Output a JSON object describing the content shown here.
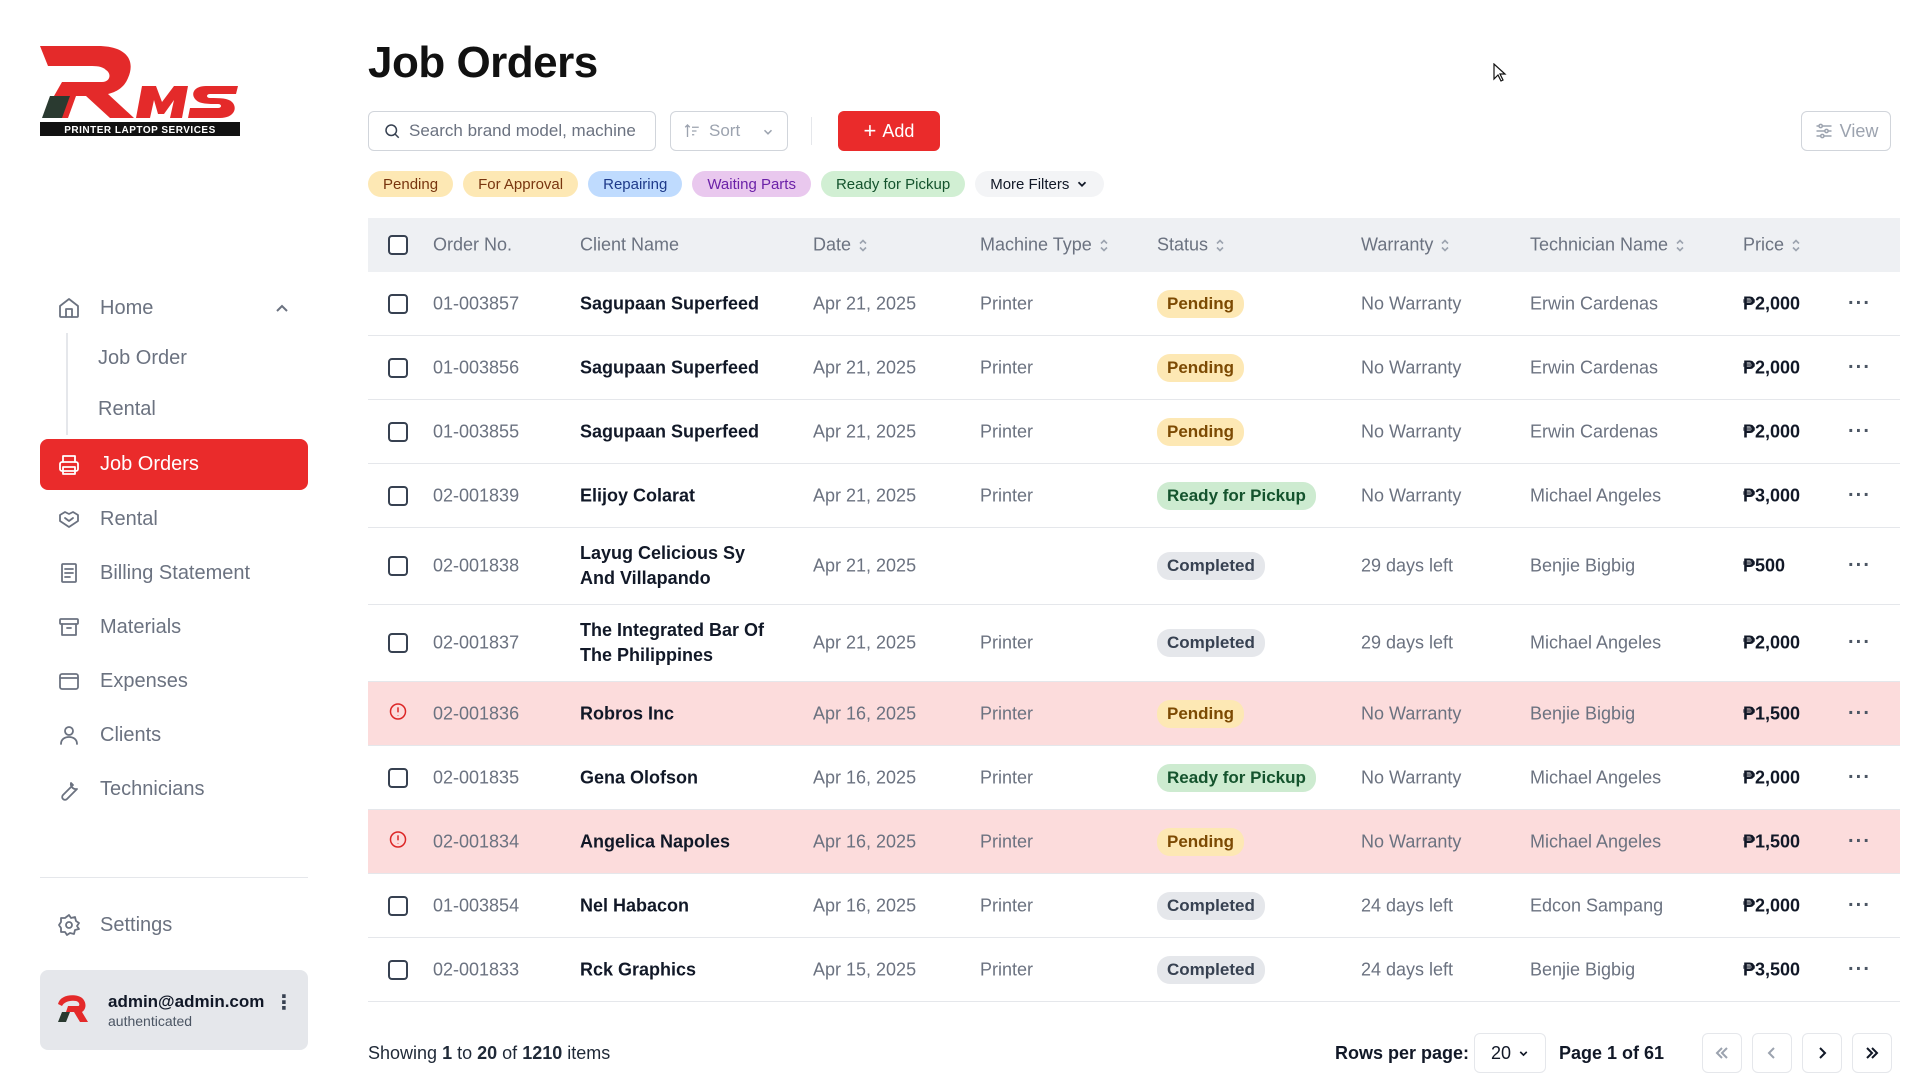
{
  "app": {
    "logo_text": "PRINTER LAPTOP SERVICES",
    "logo_mark": "RMS",
    "brand_color": "#ea2b2b"
  },
  "sidebar": {
    "home": {
      "label": "Home",
      "icon": "home-icon",
      "expanded": true
    },
    "home_children": [
      {
        "label": "Job Order"
      },
      {
        "label": "Rental"
      }
    ],
    "items": [
      {
        "label": "Job Orders",
        "icon": "printer-icon",
        "active": true
      },
      {
        "label": "Rental",
        "icon": "handshake-icon"
      },
      {
        "label": "Billing Statement",
        "icon": "document-icon"
      },
      {
        "label": "Materials",
        "icon": "archive-icon"
      },
      {
        "label": "Expenses",
        "icon": "wallet-icon"
      },
      {
        "label": "Clients",
        "icon": "user-icon"
      },
      {
        "label": "Technicians",
        "icon": "wrench-icon"
      }
    ],
    "settings": {
      "label": "Settings",
      "icon": "gear-icon"
    },
    "user": {
      "email": "admin@admin.com",
      "status": "authenticated"
    }
  },
  "page": {
    "title": "Job Orders"
  },
  "toolbar": {
    "search_placeholder": "Search brand model, machine",
    "sort_label": "Sort",
    "add_label": "Add",
    "view_label": "View"
  },
  "filters": [
    {
      "label": "Pending",
      "bg": "#fde8b4",
      "fg": "#78350f"
    },
    {
      "label": "For Approval",
      "bg": "#fde8b4",
      "fg": "#78350f"
    },
    {
      "label": "Repairing",
      "bg": "#bfdbfe",
      "fg": "#1e3a8a"
    },
    {
      "label": "Waiting Parts",
      "bg": "#e9c8ee",
      "fg": "#6b21a8"
    },
    {
      "label": "Ready for Pickup",
      "bg": "#d1efd3",
      "fg": "#14532d"
    }
  ],
  "more_filters_label": "More Filters",
  "table": {
    "columns": [
      "Order No.",
      "Client Name",
      "Date",
      "Machine Type",
      "Status",
      "Warranty",
      "Technician Name",
      "Price"
    ],
    "status_colors": {
      "Pending": {
        "bg": "#fde8b4",
        "fg": "#7c4a03"
      },
      "Ready for Pickup": {
        "bg": "#cdebd0",
        "fg": "#14532d"
      },
      "Completed": {
        "bg": "#e5e7eb",
        "fg": "#374151"
      }
    },
    "rows": [
      {
        "order": "01-003857",
        "client": "Sagupaan Superfeed",
        "date": "Apr 21, 2025",
        "machine": "Printer",
        "status": "Pending",
        "warranty": "No Warranty",
        "tech": "Erwin Cardenas",
        "price": "₱2,000",
        "flag": false
      },
      {
        "order": "01-003856",
        "client": "Sagupaan Superfeed",
        "date": "Apr 21, 2025",
        "machine": "Printer",
        "status": "Pending",
        "warranty": "No Warranty",
        "tech": "Erwin Cardenas",
        "price": "₱2,000",
        "flag": false
      },
      {
        "order": "01-003855",
        "client": "Sagupaan Superfeed",
        "date": "Apr 21, 2025",
        "machine": "Printer",
        "status": "Pending",
        "warranty": "No Warranty",
        "tech": "Erwin Cardenas",
        "price": "₱2,000",
        "flag": false
      },
      {
        "order": "02-001839",
        "client": "Elijoy Colarat",
        "date": "Apr 21, 2025",
        "machine": "Printer",
        "status": "Ready for Pickup",
        "warranty": "No Warranty",
        "tech": "Michael Angeles",
        "price": "₱3,000",
        "flag": false
      },
      {
        "order": "02-001838",
        "client": "Layug Celicious Sy And Villapando",
        "date": "Apr 21, 2025",
        "machine": "",
        "status": "Completed",
        "warranty": "29 days left",
        "tech": "Benjie Bigbig",
        "price": "₱500",
        "flag": false,
        "tall": true
      },
      {
        "order": "02-001837",
        "client": "The Integrated Bar Of The Philippines",
        "date": "Apr 21, 2025",
        "machine": "Printer",
        "status": "Completed",
        "warranty": "29 days left",
        "tech": "Michael Angeles",
        "price": "₱2,000",
        "flag": false,
        "tall": true
      },
      {
        "order": "02-001836",
        "client": "Robros Inc",
        "date": "Apr 16, 2025",
        "machine": "Printer",
        "status": "Pending",
        "warranty": "No Warranty",
        "tech": "Benjie Bigbig",
        "price": "₱1,500",
        "flag": true
      },
      {
        "order": "02-001835",
        "client": "Gena Olofson",
        "date": "Apr 16, 2025",
        "machine": "Printer",
        "status": "Ready for Pickup",
        "warranty": "No Warranty",
        "tech": "Michael Angeles",
        "price": "₱2,000",
        "flag": false
      },
      {
        "order": "02-001834",
        "client": "Angelica Napoles",
        "date": "Apr 16, 2025",
        "machine": "Printer",
        "status": "Pending",
        "warranty": "No Warranty",
        "tech": "Michael Angeles",
        "price": "₱1,500",
        "flag": true
      },
      {
        "order": "01-003854",
        "client": "Nel Habacon",
        "date": "Apr 16, 2025",
        "machine": "Printer",
        "status": "Completed",
        "warranty": "24 days left",
        "tech": "Edcon Sampang",
        "price": "₱2,000",
        "flag": false
      },
      {
        "order": "02-001833",
        "client": "Rck Graphics",
        "date": "Apr 15, 2025",
        "machine": "Printer",
        "status": "Completed",
        "warranty": "24 days left",
        "tech": "Benjie Bigbig",
        "price": "₱3,500",
        "flag": false
      }
    ]
  },
  "footer": {
    "showing_prefix": "Showing",
    "range_start": "1",
    "to": "to",
    "range_end": "20",
    "of": "of",
    "total": "1210",
    "items_suffix": "items",
    "rows_per_page_label": "Rows per page:",
    "rows_per_page_value": "20",
    "page_label": "Page 1 of 61"
  }
}
